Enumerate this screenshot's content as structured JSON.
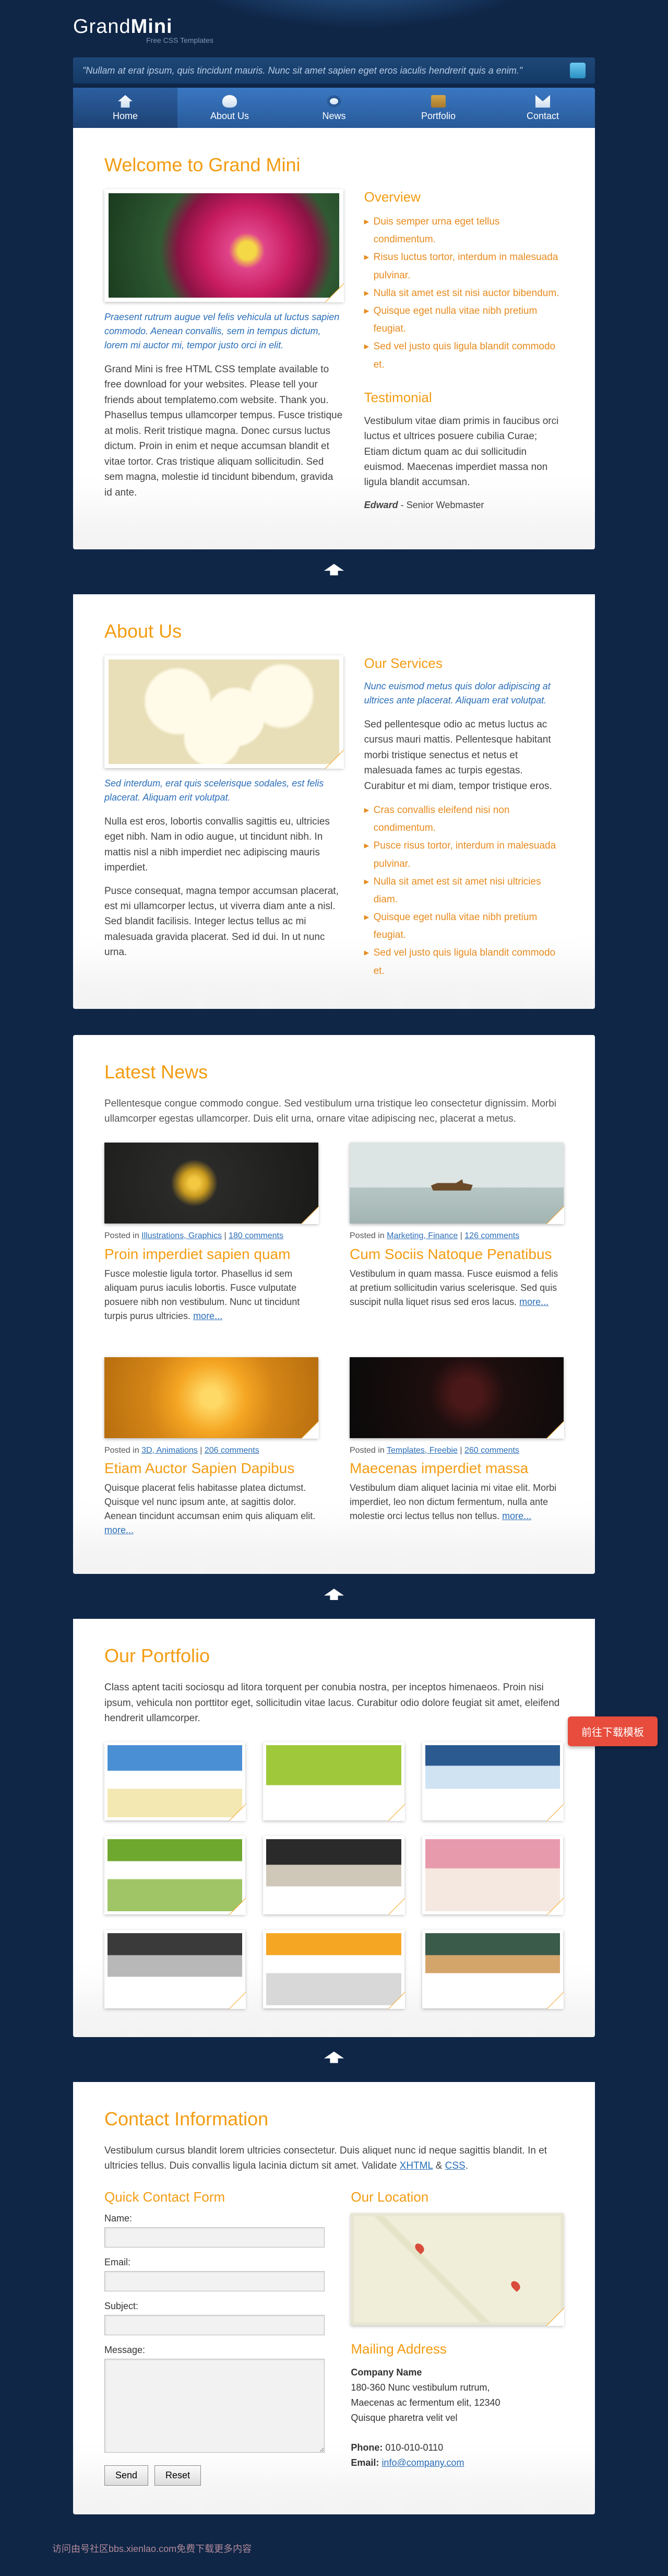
{
  "header": {
    "logo_a": "Grand",
    "logo_b": "Mini",
    "sub": "Free CSS Templates",
    "tagline": "\"Nullam at erat ipsum, quis tincidunt mauris. Nunc sit amet sapien eget eros iaculis hendrerit quis a enim.\""
  },
  "menu": [
    {
      "label": "Home"
    },
    {
      "label": "About Us"
    },
    {
      "label": "News"
    },
    {
      "label": "Portfolio"
    },
    {
      "label": "Contact"
    }
  ],
  "home": {
    "title": "Welcome to Grand Mini",
    "caption": "Praesent rutrum augue vel felis vehicula ut luctus sapien commodo. Aenean convallis, sem in tempus dictum, lorem mi auctor mi, tempor justo orci in elit.",
    "para": "Grand Mini is free HTML CSS template available to free download for your websites. Please tell your friends about templatemo.com website. Thank you. Phasellus tempus ullamcorper tempus. Fusce tristique at molis. Rerit tristique magna. Donec cursus luctus dictum. Proin in enim et neque accumsan blandit et vitae tortor. Cras tristique aliquam sollicitudin. Sed sem magna, molestie id tincidunt bibendum, gravida id ante.",
    "ov_title": "Overview",
    "ov_items": [
      "Duis semper urna eget tellus condimentum.",
      "Risus luctus tortor, interdum in malesuada pulvinar.",
      "Nulla sit amet est sit nisi auctor bibendum.",
      "Quisque eget nulla vitae nibh pretium feugiat.",
      "Sed vel justo quis ligula blandit commodo et."
    ],
    "tm_title": "Testimonial",
    "tm_text": "Vestibulum vitae diam primis in faucibus orci luctus et ultrices posuere cubilia Curae; Etiam dictum quam ac dui sollicitudin euismod. Maecenas imperdiet massa non ligula blandit accumsan.",
    "tm_author": "Edward",
    "tm_role": "- Senior Webmaster"
  },
  "about": {
    "title": "About Us",
    "caption": "Sed interdum, erat quis scelerisque sodales, est felis placerat. Aliquam erit volutpat.",
    "p1": "Nulla est eros, lobortis convallis sagittis eu, ultricies eget nibh. Nam in odio augue, ut tincidunt nibh. In mattis nisl a nibh imperdiet nec adipiscing mauris imperdiet.",
    "p2": "Pusce consequat, magna tempor accumsan placerat, est mi ullamcorper lectus, ut viverra diam ante a nisl. Sed blandit facilisis. Integer lectus tellus ac mi malesuada gravida placerat. Sed id dui. In ut nunc urna.",
    "sv_title": "Our Services",
    "sv_text": "Nunc euismod metus quis dolor adipiscing at ultrices ante placerat. Aliquam erat volutpat.",
    "sv_p": "Sed pellentesque odio ac metus luctus ac cursus mauri mattis. Pellentesque habitant morbi tristique senectus et netus et malesuada fames ac turpis egestas. Curabitur et mi diam, tempor tristique eros.",
    "sv_items": [
      "Cras convallis eleifend nisi non condimentum.",
      "Pusce risus tortor, interdum in malesuada pulvinar.",
      "Nulla sit amet est sit amet nisi ultricies diam.",
      "Quisque eget nulla vitae nibh pretium feugiat.",
      "Sed vel justo quis ligula blandit commodo et."
    ]
  },
  "news": {
    "title": "Latest News",
    "intro": "Pellentesque congue commodo congue. Sed vestibulum urna tristique leo consectetur dignissim. Morbi ullamcorper egestas ullamcorper. Duis elit urna, ornare vitae adipiscing nec, placerat a metus.",
    "items": [
      {
        "meta_a": "Posted in ",
        "cats": "Illustrations, Graphics",
        "cm": "180 comments",
        "h": "Proin imperdiet sapien quam",
        "body": "Fusce molestie ligula tortor. Phasellus id sem aliquam purus iaculis lobortis. Fusce vulputate posuere nibh non vestibulum. Nunc ut tincidunt turpis purus ultricies. ",
        "more": "more..."
      },
      {
        "meta_a": "Posted in ",
        "cats": "Marketing, Finance",
        "cm": "126 comments",
        "h": "Cum Sociis Natoque Penatibus",
        "body": "Vestibulum in quam massa. Fusce euismod a felis at pretium sollicitudin varius scelerisque. Sed quis suscipit nulla liquet risus sed eros lacus. ",
        "more": "more..."
      },
      {
        "meta_a": "Posted in ",
        "cats": "3D, Animations",
        "cm": "206 comments",
        "h": "Etiam Auctor Sapien Dapibus",
        "body": "Quisque placerat felis habitasse platea dictumst. Quisque vel nunc ipsum ante, at sagittis dolor. Aenean tincidunt accumsan enim quis aliquam elit. ",
        "more": "more..."
      },
      {
        "meta_a": "Posted in ",
        "cats": "Templates, Freebie",
        "cm": "260 comments",
        "h": "Maecenas imperdiet massa",
        "body": "Vestibulum diam aliquet lacinia mi vitae elit. Morbi imperdiet, leo non dictum fermentum, nulla ante molestie orci lectus tellus non tellus. ",
        "more": "more..."
      }
    ]
  },
  "port": {
    "title": "Our Portfolio",
    "intro": "Class aptent taciti sociosqu ad litora torquent per conubia nostra, per inceptos himenaeos. Proin nisi ipsum, vehicula non porttitor eget, sollicitudin vitae lacus. Curabitur odio dolore feugiat sit amet, eleifend hendrerit ullamcorper."
  },
  "contact": {
    "title": "Contact Information",
    "intro_a": "Vestibulum cursus blandit lorem ultricies consectetur. Duis aliquet nunc id neque sagittis blandit. In et ultricies tellus. Duis convallis ligula lacinia dictum sit amet. Validate ",
    "xhtml": "XHTML",
    "amp": " & ",
    "css": "CSS",
    "dot": ".",
    "form_h": "Quick Contact Form",
    "lbl_name": "Name:",
    "lbl_email": "Email:",
    "lbl_subject": "Subject:",
    "lbl_message": "Message:",
    "btn_send": "Send",
    "btn_reset": "Reset",
    "loc_h": "Our Location",
    "mail_h": "Mailing Address",
    "company": "Company Name",
    "a1": "180-360 Nunc vestibulum rutrum,",
    "a2": "Maecenas ac fermentum elit, 12340",
    "a3": "Quisque pharetra velit vel",
    "phone_l": "Phone:",
    "phone": "010-010-0110",
    "email_l": "Email:",
    "email": "info@company.com"
  },
  "red_btn": "前往下载模板",
  "bottom": "访问由号社区bbs.xienlao.com免费下载更多内容"
}
